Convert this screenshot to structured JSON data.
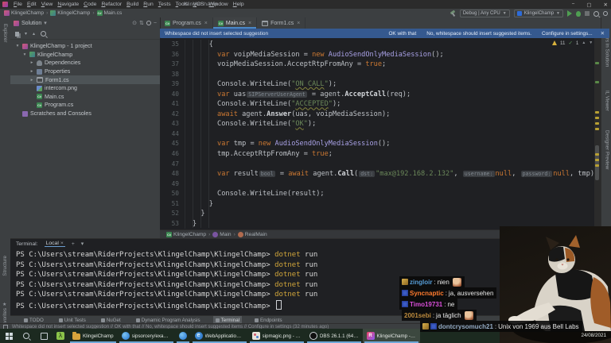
{
  "window": {
    "title": "KlingelChamp",
    "menus": [
      "File",
      "Edit",
      "View",
      "Navigate",
      "Code",
      "Refactor",
      "Build",
      "Run",
      "Tests",
      "Tools",
      "VCS",
      "Window",
      "Help"
    ],
    "controls": {
      "minimize": "−",
      "maximize": "▢",
      "close": "✕"
    }
  },
  "nav": {
    "breadcrumbs": [
      {
        "label": "KlingelChamp",
        "icon": "solution-icon"
      },
      {
        "label": "KlingelChamp",
        "icon": "project-icon"
      },
      {
        "label": "Main.cs",
        "icon": "csharp-file"
      }
    ],
    "solution_config": "Debug | Any CPU",
    "run_config": "KlingelChamp"
  },
  "tabs": [
    {
      "label": "Program.cs",
      "icon": "csharp",
      "active": false
    },
    {
      "label": "Main.cs",
      "icon": "csharp",
      "active": true
    },
    {
      "label": "Form1.cs",
      "icon": "form",
      "active": false
    }
  ],
  "banner": {
    "message": "Whitespace did not insert selected suggestion",
    "actions": [
      "OK with that",
      "No, whitespace should insert suggested items.",
      "Configure in settings..."
    ],
    "close": "✕"
  },
  "left_strip": {
    "top": "Explorer",
    "bottom": [
      "Structure",
      "Favorites"
    ]
  },
  "solution_panel": {
    "header": "Solution",
    "tree": [
      {
        "label": "KlingelChamp - 1 project",
        "level": 0,
        "arrow": "▾",
        "icon": "solution",
        "selected": false
      },
      {
        "label": "KlingelChamp",
        "level": 1,
        "arrow": "▾",
        "icon": "project",
        "selected": false
      },
      {
        "label": "Dependencies",
        "level": 2,
        "arrow": "▸",
        "icon": "dependencies",
        "selected": false
      },
      {
        "label": "Properties",
        "level": 2,
        "arrow": "▸",
        "icon": "properties",
        "selected": false
      },
      {
        "label": "Form1.cs",
        "level": 2,
        "arrow": "▸",
        "icon": "form",
        "selected": true
      },
      {
        "label": "intercom.png",
        "level": 2,
        "arrow": "",
        "icon": "image",
        "selected": false
      },
      {
        "label": "Main.cs",
        "level": 2,
        "arrow": "",
        "icon": "csharp",
        "selected": false
      },
      {
        "label": "Program.cs",
        "level": 2,
        "arrow": "",
        "icon": "csharp",
        "selected": false
      },
      {
        "label": "Scratches and Consoles",
        "level": 0,
        "arrow": "",
        "icon": "scratches",
        "selected": false
      }
    ]
  },
  "editor": {
    "inspections": {
      "warnings": "11",
      "passed": "1"
    },
    "code": [
      {
        "n": "35",
        "seg": [
          [
            "p",
            "    {"
          ]
        ]
      },
      {
        "n": "36",
        "seg": [
          [
            "p",
            "      "
          ],
          [
            "kw",
            "var"
          ],
          [
            "p",
            " voipMediaSession = "
          ],
          [
            "kw",
            "new"
          ],
          [
            "p",
            " "
          ],
          [
            "ty",
            "AudioSendOnlyMediaSession"
          ],
          [
            "p",
            "();"
          ]
        ]
      },
      {
        "n": "37",
        "seg": [
          [
            "p",
            "      voipMediaSession.AcceptRtpFromAny = "
          ],
          [
            "kw",
            "true"
          ],
          [
            "p",
            ";"
          ]
        ]
      },
      {
        "n": "38",
        "seg": []
      },
      {
        "n": "39",
        "seg": [
          [
            "p",
            "      Console.WriteLine("
          ],
          [
            "st",
            "\""
          ],
          [
            "stu",
            "ON CALL"
          ],
          [
            "st",
            "\""
          ],
          [
            "p",
            ");"
          ]
        ]
      },
      {
        "n": "40",
        "seg": [
          [
            "p",
            "      "
          ],
          [
            "kw",
            "var"
          ],
          [
            "p",
            " uas"
          ],
          [
            "in",
            "SIPServerUserAgent"
          ],
          [
            "p",
            " = agent."
          ],
          [
            "me",
            "AcceptCall"
          ],
          [
            "p",
            "(req);"
          ]
        ]
      },
      {
        "n": "41",
        "seg": [
          [
            "p",
            "      Console.WriteLine("
          ],
          [
            "st",
            "\""
          ],
          [
            "stu",
            "ACCEPTED"
          ],
          [
            "st",
            "\""
          ],
          [
            "p",
            ");"
          ]
        ]
      },
      {
        "n": "42",
        "seg": [
          [
            "p",
            "      "
          ],
          [
            "kw",
            "await"
          ],
          [
            "p",
            " agent."
          ],
          [
            "me",
            "Answer"
          ],
          [
            "p",
            "(uas, voipMediaSession);"
          ]
        ]
      },
      {
        "n": "43",
        "seg": [
          [
            "p",
            "      Console.WriteLine("
          ],
          [
            "st",
            "\""
          ],
          [
            "stu",
            "OK"
          ],
          [
            "st",
            "\""
          ],
          [
            "p",
            ");"
          ]
        ]
      },
      {
        "n": "44",
        "seg": []
      },
      {
        "n": "45",
        "seg": [
          [
            "p",
            "      "
          ],
          [
            "kw",
            "var"
          ],
          [
            "p",
            " tmp = "
          ],
          [
            "kw",
            "new"
          ],
          [
            "p",
            " "
          ],
          [
            "ty",
            "AudioSendOnlyMediaSession"
          ],
          [
            "p",
            "();"
          ]
        ]
      },
      {
        "n": "46",
        "seg": [
          [
            "p",
            "      tmp.AcceptRtpFromAny = "
          ],
          [
            "kw",
            "true"
          ],
          [
            "p",
            ";"
          ]
        ]
      },
      {
        "n": "47",
        "seg": []
      },
      {
        "n": "48",
        "seg": [
          [
            "p",
            "      "
          ],
          [
            "kw",
            "var"
          ],
          [
            "p",
            " result"
          ],
          [
            "in",
            "bool"
          ],
          [
            "p",
            " = "
          ],
          [
            "kw",
            "await"
          ],
          [
            "p",
            " agent."
          ],
          [
            "me",
            "Call"
          ],
          [
            "p",
            "("
          ],
          [
            "in",
            "dst:"
          ],
          [
            "st",
            "\"max@192.168.2.132\""
          ],
          [
            "p",
            ", "
          ],
          [
            "in",
            "username:"
          ],
          [
            "kw",
            "null"
          ],
          [
            "p",
            ", "
          ],
          [
            "in",
            "password:"
          ],
          [
            "kw",
            "null"
          ],
          [
            "p",
            ", tmp);"
          ]
        ]
      },
      {
        "n": "49",
        "seg": []
      },
      {
        "n": "50",
        "seg": [
          [
            "p",
            "      Console.WriteLine(result);"
          ]
        ]
      },
      {
        "n": "51",
        "seg": [
          [
            "p",
            "    }"
          ]
        ]
      },
      {
        "n": "52",
        "seg": [
          [
            "p",
            "  }"
          ]
        ]
      },
      {
        "n": "53",
        "seg": [
          [
            "p",
            "}"
          ]
        ]
      }
    ],
    "breadcrumbs": [
      {
        "label": "KlingelChamp",
        "icon": "csharp"
      },
      {
        "label": "Main",
        "icon": "class"
      },
      {
        "label": "RealMain",
        "icon": "method"
      }
    ]
  },
  "right_strip": [
    "Errors in Solution",
    "IL Viewer",
    "Designer Preview"
  ],
  "terminal": {
    "label": "Terminal:",
    "tab": "Local",
    "tab_close": "×",
    "new_tab": "+",
    "dropdown": "▾",
    "prompt": "PS C:\\Users\\stream\\RiderProjects\\KlingelChamp\\KlingelChamp>",
    "command": "dotnet",
    "argument": "run",
    "repeat": 5
  },
  "tool_bar": {
    "items": [
      {
        "label": "TODO",
        "active": false
      },
      {
        "label": "Unit Tests",
        "active": false
      },
      {
        "label": "NuGet",
        "active": false
      },
      {
        "label": "Dynamic Program Analysis",
        "active": false
      },
      {
        "label": "Terminal",
        "active": true
      },
      {
        "label": "Endpoints",
        "active": false
      }
    ]
  },
  "status_bar": {
    "message": "Whitespace did not insert selected suggestion // OK with that // No, whitespace should insert suggested items // Configure in settings (32 minutes ago)"
  },
  "taskbar": {
    "apps": [
      {
        "label": "",
        "icon": "lambda",
        "open": false,
        "active": false
      },
      {
        "label": "KlingelChamp",
        "icon": "folder",
        "open": true,
        "active": false
      },
      {
        "label": "sipsorcery/example...",
        "icon": "globe",
        "open": true,
        "active": false
      },
      {
        "label": "",
        "icon": "globe",
        "open": true,
        "active": false
      },
      {
        "label": "WebApplication11...",
        "icon": "edge",
        "open": true,
        "active": false
      },
      {
        "label": "sipmagic.png - Paint",
        "icon": "paint",
        "open": true,
        "active": false
      },
      {
        "label": "OBS 26.1.1 (64-bit, ...",
        "icon": "obs",
        "open": true,
        "active": false
      },
      {
        "label": "KlingelChamp - M...",
        "icon": "rider",
        "open": true,
        "active": true
      }
    ],
    "date": "24/08/2021"
  },
  "chat": {
    "messages": [
      {
        "user": "zingloir",
        "color": "#569cd6",
        "text": "nien",
        "badges": [
          "gold"
        ],
        "emote": true
      },
      {
        "user": "Syncnaptic",
        "color": "#ff7b2e",
        "text": "ja, ausversehen",
        "badges": [
          "blue"
        ],
        "emote": false
      },
      {
        "user": "Timo19731",
        "color": "#d94fd9",
        "text": "ne",
        "badges": [
          "blue"
        ],
        "emote": false
      },
      {
        "user": "2001sebi",
        "color": "#bd8b3d",
        "text": "ja täglich",
        "badges": [],
        "emote": true
      },
      {
        "user": "dontcrysomuch21",
        "color": "#94abc4",
        "text": "Unix von 1969 aus Bell Labs",
        "badges": [
          "gold",
          "blue"
        ],
        "emote": false
      }
    ]
  }
}
